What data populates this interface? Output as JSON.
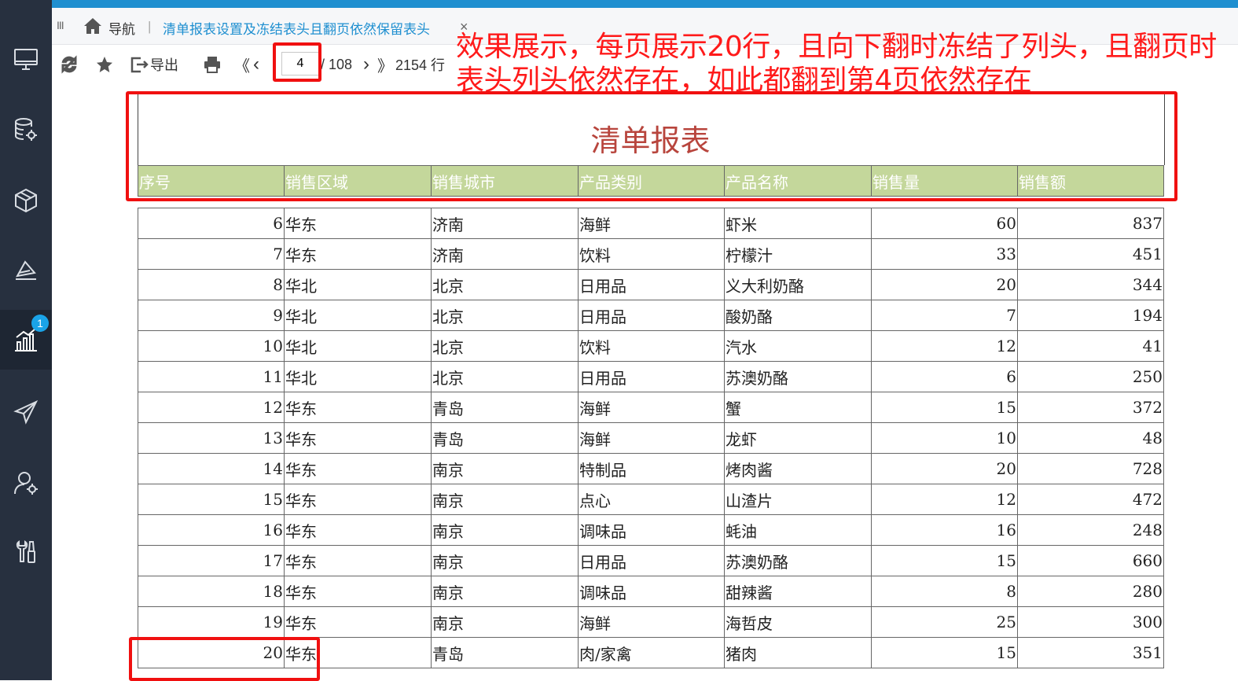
{
  "tabs": {
    "nav_label": "导航",
    "active_tab": "清单报表设置及冻结表头且翻页依然保留表头",
    "close_symbol": "×",
    "menu_symbol": "III",
    "separator": "|"
  },
  "sidebar": {
    "items": [
      {
        "icon": "monitor-icon"
      },
      {
        "icon": "database-settings-icon"
      },
      {
        "icon": "cube-icon"
      },
      {
        "icon": "layers-icon"
      },
      {
        "icon": "chart-icon",
        "badge": "1",
        "active": true
      },
      {
        "icon": "send-icon"
      },
      {
        "icon": "user-settings-icon"
      },
      {
        "icon": "tools-icon"
      }
    ]
  },
  "toolbar": {
    "export_label": "导出",
    "first_symbol": "《",
    "prev_symbol": "‹",
    "next_symbol": "›",
    "last_symbol": "》",
    "current_page": "4",
    "total_pages": "/ 108",
    "total_rows": "2154 行"
  },
  "annotation": "效果展示，每页展示20行，且向下翻时冻结了列头，且翻页时表头列头依然存在，如此都翻到第4页依然存在",
  "report": {
    "title": "清单报表",
    "columns": [
      "序号",
      "销售区域",
      "销售城市",
      "产品类别",
      "产品名称",
      "销售量",
      "销售额"
    ],
    "rows": [
      [
        "6",
        "华东",
        "济南",
        "海鲜",
        "虾米",
        "60",
        "837"
      ],
      [
        "7",
        "华东",
        "济南",
        "饮料",
        "柠檬汁",
        "33",
        "451"
      ],
      [
        "8",
        "华北",
        "北京",
        "日用品",
        "义大利奶酪",
        "20",
        "344"
      ],
      [
        "9",
        "华北",
        "北京",
        "日用品",
        "酸奶酪",
        "7",
        "194"
      ],
      [
        "10",
        "华北",
        "北京",
        "饮料",
        "汽水",
        "12",
        "41"
      ],
      [
        "11",
        "华北",
        "北京",
        "日用品",
        "苏澳奶酪",
        "6",
        "250"
      ],
      [
        "12",
        "华东",
        "青岛",
        "海鲜",
        "蟹",
        "15",
        "372"
      ],
      [
        "13",
        "华东",
        "青岛",
        "海鲜",
        "龙虾",
        "10",
        "48"
      ],
      [
        "14",
        "华东",
        "南京",
        "特制品",
        "烤肉酱",
        "20",
        "728"
      ],
      [
        "15",
        "华东",
        "南京",
        "点心",
        "山渣片",
        "12",
        "472"
      ],
      [
        "16",
        "华东",
        "南京",
        "调味品",
        "蚝油",
        "16",
        "248"
      ],
      [
        "17",
        "华东",
        "南京",
        "日用品",
        "苏澳奶酪",
        "15",
        "660"
      ],
      [
        "18",
        "华东",
        "南京",
        "调味品",
        "甜辣酱",
        "8",
        "280"
      ],
      [
        "19",
        "华东",
        "南京",
        "海鲜",
        "海哲皮",
        "25",
        "300"
      ],
      [
        "20",
        "华东",
        "青岛",
        "肉/家禽",
        "猪肉",
        "15",
        "351"
      ]
    ]
  },
  "colors": {
    "accent": "#1f8fd0",
    "sidebar": "#27303f",
    "header_bg": "#c4d79b",
    "title": "#b8453d",
    "highlight": "#f01010"
  }
}
